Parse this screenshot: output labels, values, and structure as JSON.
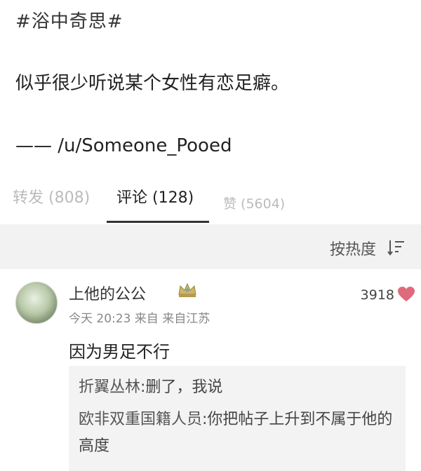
{
  "post": {
    "hashtag": "#浴中奇思#",
    "text": "似乎很少听说某个女性有恋足癖。",
    "attribution": "—— /u/Someone_Pooed"
  },
  "tabs": [
    {
      "label": "转发 (808)",
      "active": false
    },
    {
      "label": "评论 (128)",
      "active": true
    },
    {
      "label": "赞 (5604)",
      "active": false
    }
  ],
  "sort": {
    "label": "按热度",
    "icon": "sort-icon"
  },
  "comment": {
    "username": "上他的公公",
    "badge_icon": "crown-badge-icon",
    "meta": "今天 20:23 来自 来自江苏",
    "likes": "3918",
    "like_icon": "heart-icon",
    "like_color": "#e06a7a",
    "text": "因为男足不行",
    "replies": [
      {
        "author": "折翼丛林",
        "text": ":删了，我说"
      },
      {
        "author": "欧非双重国籍人员",
        "text": ":你把帖子上升到不属于他的高度"
      }
    ]
  }
}
